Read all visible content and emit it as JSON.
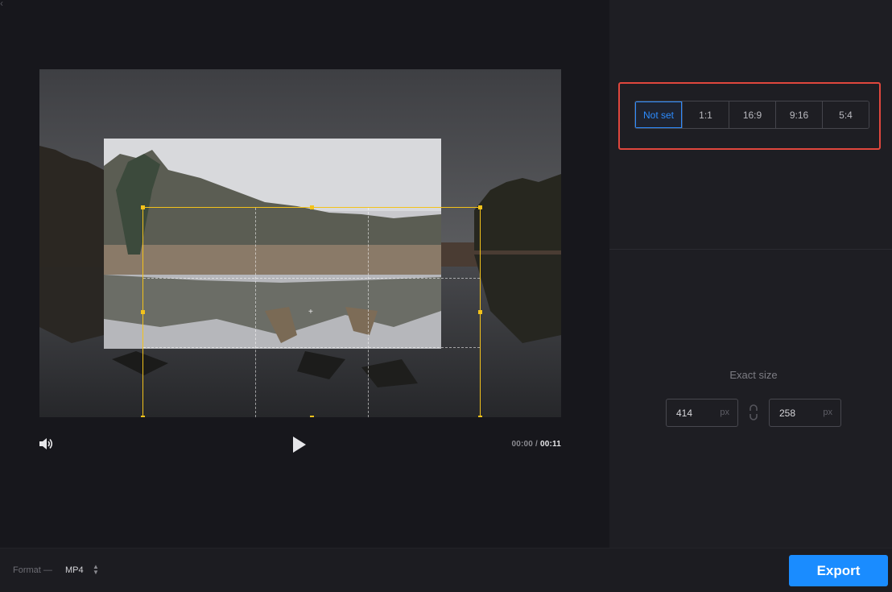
{
  "aspect_ratio": {
    "options": [
      {
        "label": "Not set",
        "active": true
      },
      {
        "label": "1:1",
        "active": false
      },
      {
        "label": "16:9",
        "active": false
      },
      {
        "label": "9:16",
        "active": false
      },
      {
        "label": "5:4",
        "active": false
      }
    ]
  },
  "exact_size": {
    "label": "Exact size",
    "width": "414",
    "height": "258",
    "unit": "px"
  },
  "player": {
    "current_time": "00:00",
    "separator": "/",
    "total_time": "00:11",
    "volume_icon": "speaker-icon",
    "play_icon": "play-icon"
  },
  "footer": {
    "format_label": "Format —",
    "format_value": "MP4",
    "export_label": "Export"
  },
  "colors": {
    "accent": "#1a8cff",
    "crop_border": "#f3c21b",
    "highlight_frame": "#e0473d"
  }
}
